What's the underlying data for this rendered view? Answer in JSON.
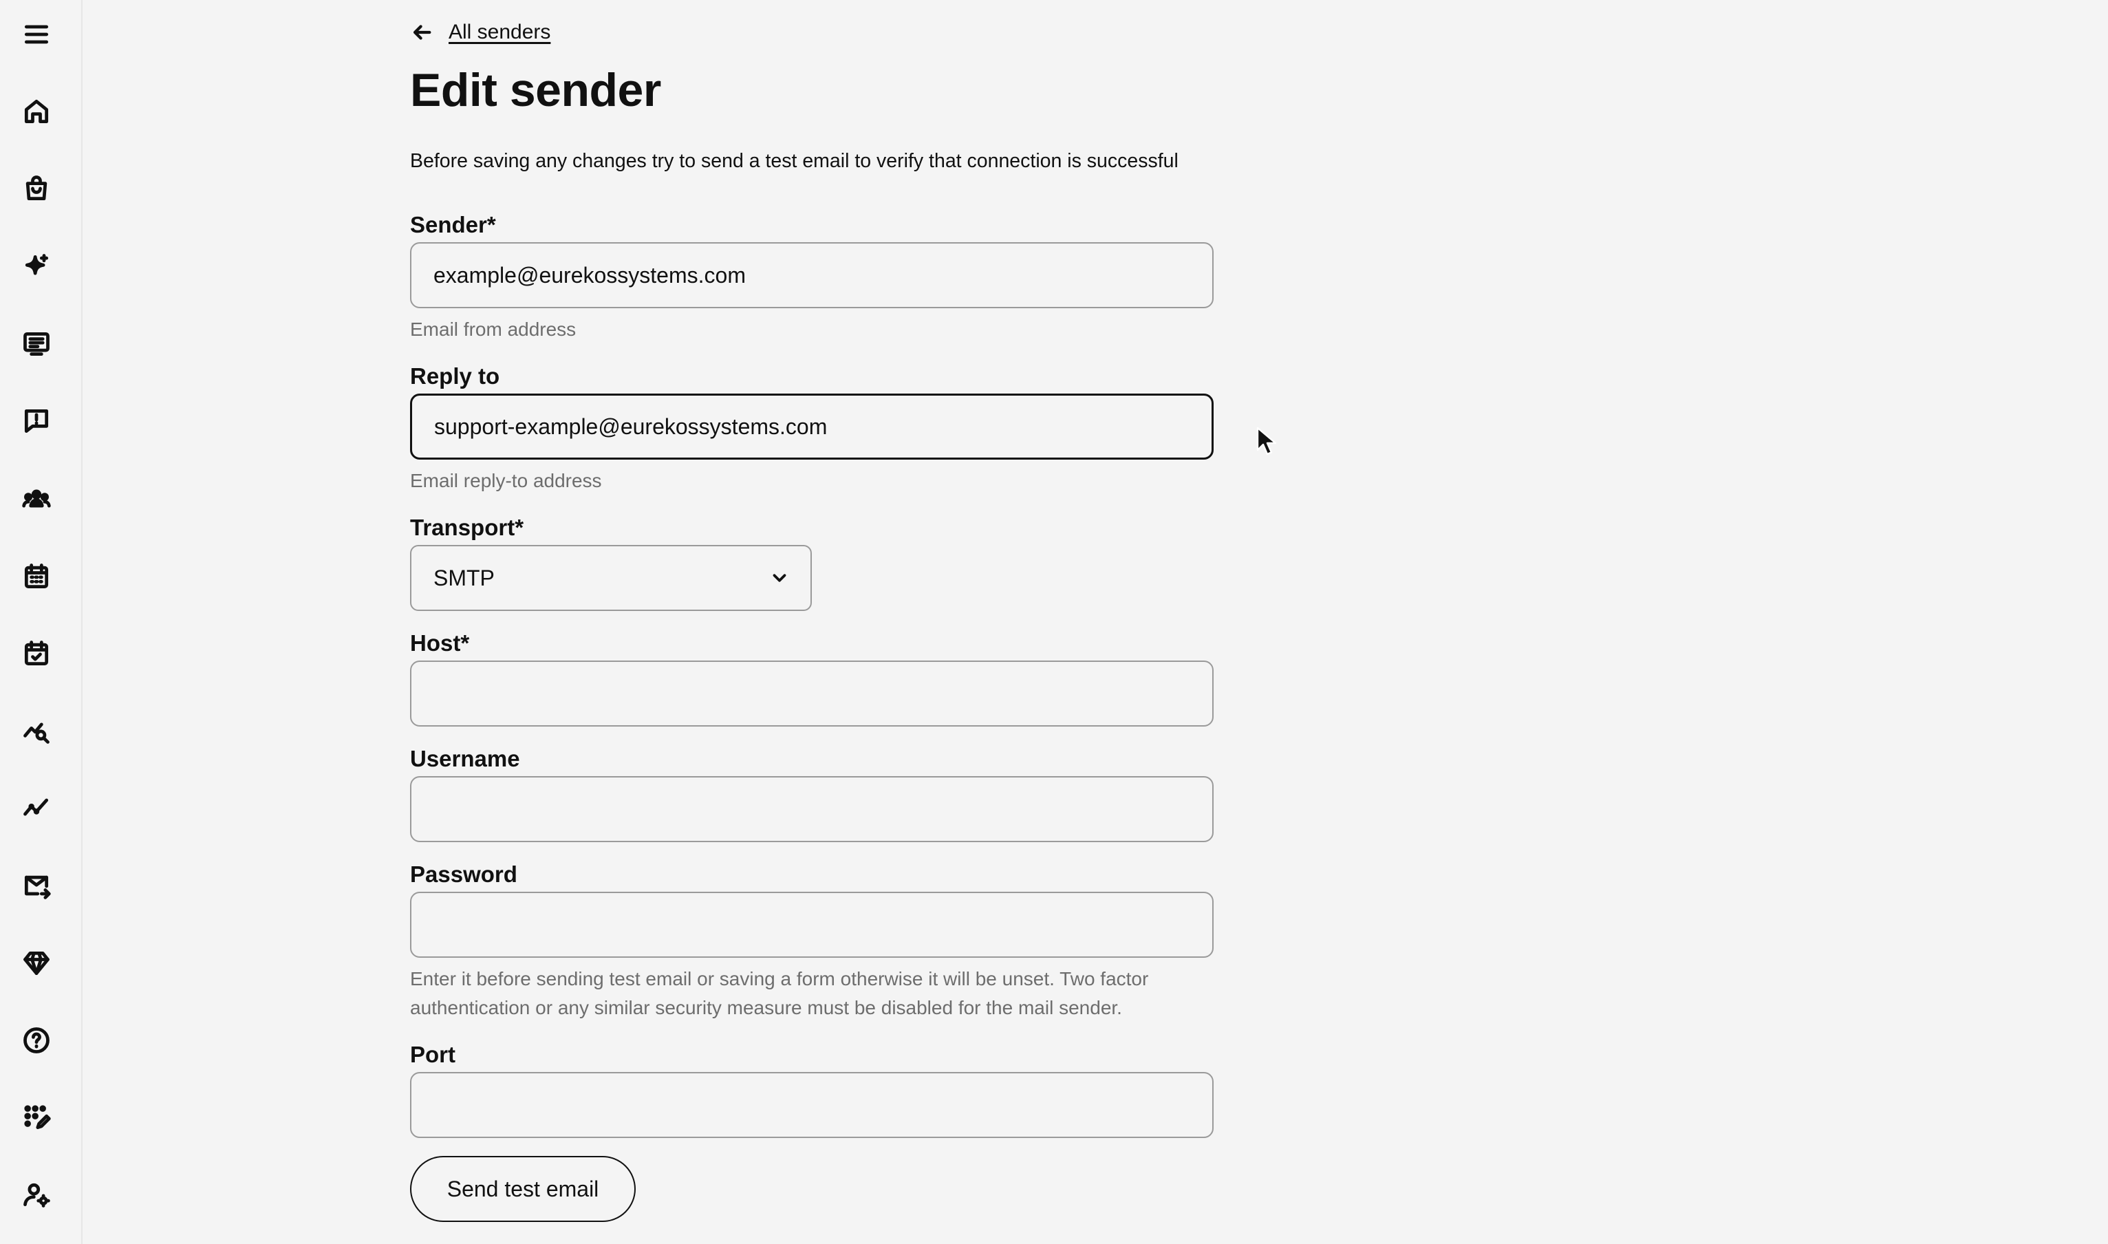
{
  "sidebar": {
    "icons": [
      "menu-icon",
      "home-icon",
      "shopping-bag-icon",
      "sparkles-icon",
      "screen-list-icon",
      "feedback-icon",
      "users-icon",
      "calendar-icon",
      "calendar-check-icon",
      "analytics-search-icon",
      "trend-line-icon",
      "mail-forward-icon",
      "diamond-icon",
      "help-icon",
      "dots-edit-icon",
      "user-settings-icon"
    ]
  },
  "back_link": {
    "label": "All senders"
  },
  "page": {
    "title": "Edit sender",
    "intro": "Before saving any changes try to send a test email to verify that connection is successful"
  },
  "form": {
    "sender": {
      "label": "Sender*",
      "value": "example@eurekossystems.com",
      "help": "Email from address"
    },
    "reply_to": {
      "label": "Reply to",
      "value": "support-example@eurekossystems.com",
      "help": "Email reply-to address"
    },
    "transport": {
      "label": "Transport*",
      "value": "SMTP"
    },
    "host": {
      "label": "Host*",
      "value": ""
    },
    "username": {
      "label": "Username",
      "value": ""
    },
    "password": {
      "label": "Password",
      "value": "",
      "help": "Enter it before sending test email or saving a form otherwise it will be unset. Two factor authentication or any similar security measure must be disabled for the mail sender."
    },
    "port": {
      "label": "Port",
      "value": ""
    },
    "send_test_label": "Send test email"
  }
}
